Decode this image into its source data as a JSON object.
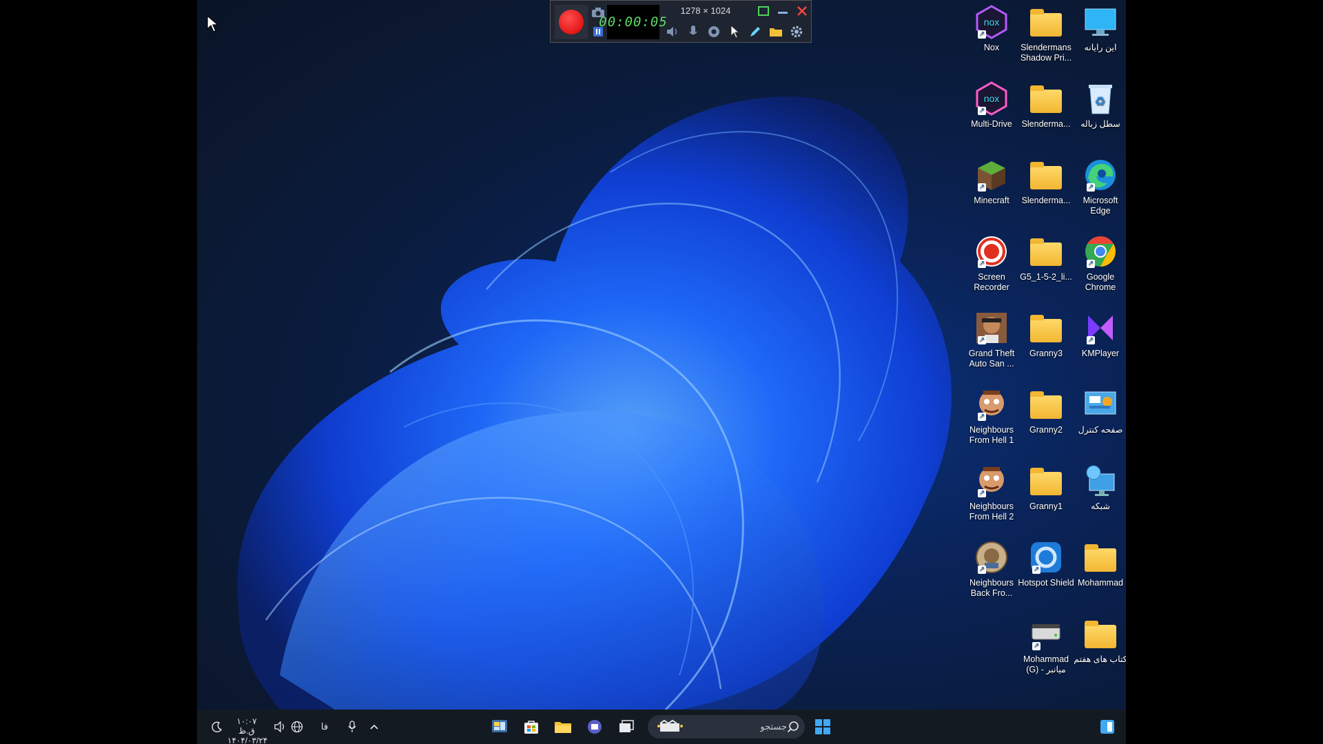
{
  "recorder": {
    "timer": "00:00:05",
    "dimensions": "1278 × 1024",
    "icons": [
      "record-icon",
      "camera-icon",
      "pause-icon",
      "speaker-icon",
      "microphone-icon",
      "webcam-icon",
      "cursor-icon",
      "pencil-icon",
      "folder-icon",
      "gear-icon",
      "restore-icon",
      "minimize-icon",
      "close-icon"
    ],
    "accent_record": "#e00000"
  },
  "desktop": {
    "icons": [
      {
        "label": "Nox",
        "type": "app",
        "icon": "nox-icon"
      },
      {
        "label": "Slendermans Shadow Pri...",
        "type": "folder",
        "icon": "folder-icon"
      },
      {
        "label": "این رایانه",
        "type": "system",
        "icon": "monitor-icon"
      },
      {
        "label": "Multi-Drive",
        "type": "app",
        "icon": "nox-icon"
      },
      {
        "label": "Slenderma...",
        "type": "folder",
        "icon": "folder-icon"
      },
      {
        "label": "سطل زباله",
        "type": "system",
        "icon": "recycle-bin-icon"
      },
      {
        "label": "Minecraft",
        "type": "app",
        "icon": "minecraft-icon"
      },
      {
        "label": "Slenderma...",
        "type": "folder",
        "icon": "folder-icon"
      },
      {
        "label": "Microsoft Edge",
        "type": "app",
        "icon": "edge-icon"
      },
      {
        "label": "Screen Recorder",
        "type": "app",
        "icon": "screen-recorder-icon"
      },
      {
        "label": "G5_1-5-2_li...",
        "type": "folder",
        "icon": "folder-icon"
      },
      {
        "label": "Google Chrome",
        "type": "app",
        "icon": "chrome-icon"
      },
      {
        "label": "Grand Theft Auto San ...",
        "type": "app",
        "icon": "gta-icon"
      },
      {
        "label": "Granny3",
        "type": "folder",
        "icon": "folder-icon"
      },
      {
        "label": "KMPlayer",
        "type": "app",
        "icon": "kmplayer-icon"
      },
      {
        "label": "Neighbours From Hell 1",
        "type": "app",
        "icon": "neighbours-icon"
      },
      {
        "label": "Granny2",
        "type": "folder",
        "icon": "folder-icon"
      },
      {
        "label": "صفحه کنترل",
        "type": "system",
        "icon": "control-panel-icon"
      },
      {
        "label": "Neighbours From Hell 2",
        "type": "app",
        "icon": "neighbours-icon"
      },
      {
        "label": "Granny1",
        "type": "folder",
        "icon": "folder-icon"
      },
      {
        "label": "شبکه",
        "type": "system",
        "icon": "network-icon"
      },
      {
        "label": "Neighbours Back Fro...",
        "type": "app",
        "icon": "neighbours-back-icon"
      },
      {
        "label": "Hotspot Shield",
        "type": "app",
        "icon": "hotspot-shield-icon"
      },
      {
        "label": "Mohammad",
        "type": "folder",
        "icon": "folder-icon"
      },
      {
        "label": "Mohammad (G) - میانبر",
        "type": "drive",
        "icon": "drive-icon"
      },
      {
        "label": "کتاب های هفتم",
        "type": "folder",
        "icon": "folder-icon"
      }
    ]
  },
  "taskbar": {
    "time": "۱۰:۰۷ ق.ظ",
    "date": "۱۴۰۴/۰۳/۲۴",
    "language": "فا",
    "search_placeholder": "جستجو",
    "icons": [
      "moon-icon",
      "volume-icon",
      "globe-icon",
      "microphone-icon",
      "chevron-up-icon",
      "widgets-icon",
      "store-icon",
      "file-explorer-icon",
      "teams-icon",
      "task-view-icon",
      "search-icon",
      "start-icon",
      "copilot-icon"
    ]
  }
}
